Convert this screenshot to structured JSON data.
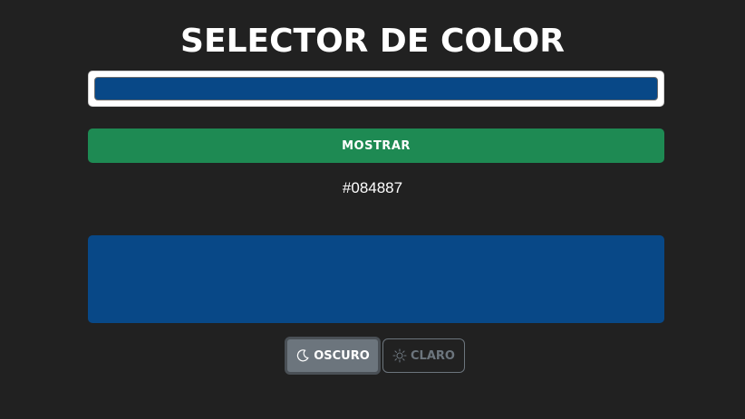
{
  "app": {
    "title": "Selector de color"
  },
  "color_picker": {
    "value": "#084887"
  },
  "show_button": {
    "label": "Mostrar",
    "color": "#1e8a53"
  },
  "result": {
    "hex_text": "#084887",
    "preview_color": "#084887"
  },
  "theme_toggle": {
    "dark_label": "Oscuro",
    "dark_icon": "moon-icon",
    "light_label": "Claro",
    "light_icon": "sun-icon",
    "selected": "dark"
  }
}
